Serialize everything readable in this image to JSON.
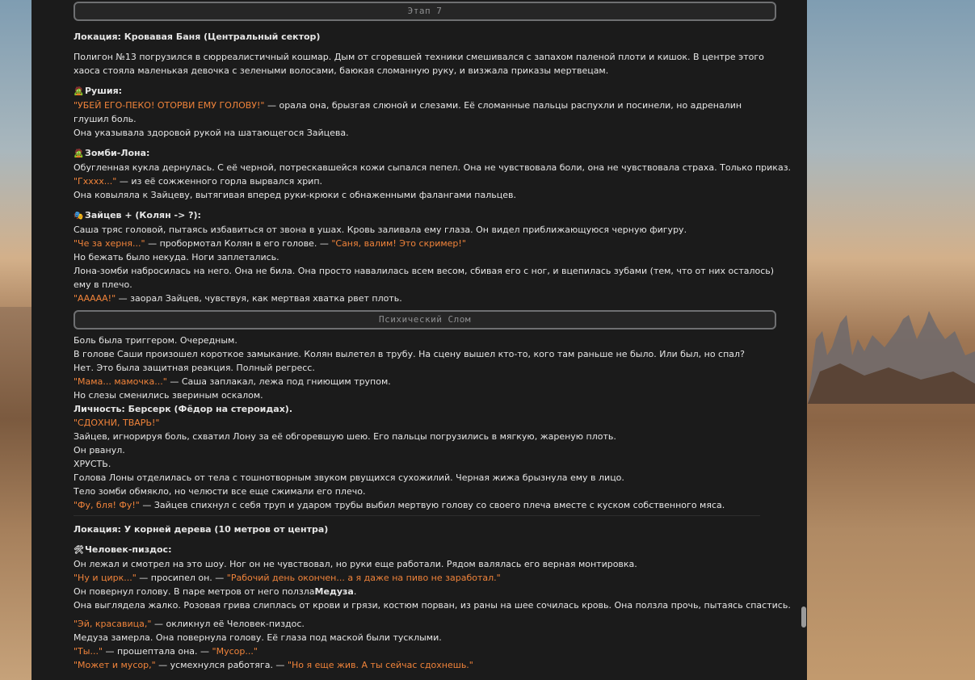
{
  "stage_title": "Этап 7",
  "loc1": "Локация: Кровавая Баня (Центральный сектор)",
  "intro": "Полигон №13 погрузился в сюрреалистичный кошмар. Дым от сгоревшей техники смешивался с запахом паленой плоти и кишок. В центре этого хаоса стояла маленькая девочка с зелеными волосами, баюкая сломанную руку, и визжала приказы мертвецам.",
  "rushia": {
    "icon": "🧟",
    "name": "Рушия:",
    "q1": "\"УБЕЙ ЕГО-ПЕКО! ОТОРВИ ЕМУ ГОЛОВУ!\"",
    "t1": " — орала она, брызгая слюной и слезами. Её сломанные пальцы распухли и посинели, но адреналин глушил боль.",
    "t2": "Она указывала здоровой рукой на шатающегося Зайцева."
  },
  "lona": {
    "icon": "🧟",
    "name": "Зомби-Лона:",
    "t1": "Обугленная кукла дернулась. С её черной, потрескавшейся кожи сыпался пепел. Она не чувствовала боли, она не чувствовала страха. Только приказ.",
    "q1": "\"Гхххх...\"",
    "t2": " — из её сожженного горла вырвался хрип.",
    "t3": "Она ковыляла к Зайцеву, вытягивая вперед руки-крюки с обнаженными фалангами пальцев."
  },
  "zaytsev": {
    "icon": "🎭",
    "name": "Зайцев + (Колян -> ?):",
    "t1": "Саша тряс головой, пытаясь избавиться от звона в ушах. Кровь заливала ему глаза. Он видел приближающуюся черную фигуру.",
    "q1": "\"Че за херня...\"",
    "t2": " — пробормотал Колян в его голове. — ",
    "q2": "\"Саня, валим! Это скример!\"",
    "t3": "Но бежать было некуда. Ноги заплетались.",
    "t4": "Лона-зомби набросилась на него. Она не била. Она просто навалилась всем весом, сбивая его с ног, и вцепилась зубами (тем, что от них осталось) ему в плечо.",
    "q3": "\"ААААА!\"",
    "t5": " — заорал Зайцев, чувствуя, как мертвая хватка рвет плоть."
  },
  "break_title": "Психический Слом",
  "brk": {
    "l1": "Боль была триггером. Очередным.",
    "l2": "В голове Саши произошел короткое замыкание. Колян вылетел в трубу. На сцену вышел кто-то, кого там раньше не было. Или был, но спал?",
    "l3": "Нет. Это была защитная реакция. Полный регресс.",
    "q1": "\"Мама... мамочка...\"",
    "l4": " — Саша заплакал, лежа под гниющим трупом.",
    "l5": "Но слезы сменились звериным оскалом.",
    "l6": "Личность: Берсерк (Фёдор на стероидах).",
    "q2": "\"СДОХНИ, ТВАРЬ!\"",
    "l7": "Зайцев, игнорируя боль, схватил Лону за её обгоревшую шею. Его пальцы погрузились в мягкую, жареную плоть.",
    "l8": "Он рванул.",
    "l9": "ХРУСТЬ.",
    "l10": "Голова Лоны отделилась от тела с тошнотворным звуком рвущихся сухожилий. Черная жижа брызнула ему в лицо.",
    "l11": "Тело зомби обмякло, но челюсти все еще сжимали его плечо.",
    "q3": "\"Фу, бля! Фу!\"",
    "l12": " — Зайцев спихнул с себя труп и ударом трубы выбил мертвую голову со своего плеча вместе с куском собственного мяса."
  },
  "loc2": "Локация: У корней дерева (10 метров от центра)",
  "chel": {
    "icon": "🛠",
    "name": "Человек-пиздос:",
    "t1": "Он лежал и смотрел на это шоу. Ног он не чувствовал, но руки еще работали. Рядом валялась его верная монтировка.",
    "q1": "\"Ну и цирк...\"",
    "t2": " — просипел он. — ",
    "q2": "\"Рабочий день окончен... а я даже на пиво не заработал.\"",
    "t3a": "Он повернул голову. В паре метров от него ползла",
    "t3b": "Медуза",
    "t3c": ".",
    "t4": "Она выглядела жалко. Розовая грива слиплась от крови и грязи, костюм порван, из раны на шее сочилась кровь. Она ползла прочь, пытаясь спастись.",
    "q3": "\"Эй, красавица,\"",
    "t5": " — окликнул её Человек-пиздос.",
    "t6": "Медуза замерла. Она повернула голову. Её глаза под маской были тусклыми.",
    "q4": "\"Ты...\"",
    "t7": " — прошептала она. — ",
    "q5": "\"Мусор...\"",
    "q6": "\"Может и мусор,\"",
    "t8": " — усмехнулся работяга. — ",
    "q7": "\"Но я еще жив. А ты сейчас сдохнешь.\""
  }
}
